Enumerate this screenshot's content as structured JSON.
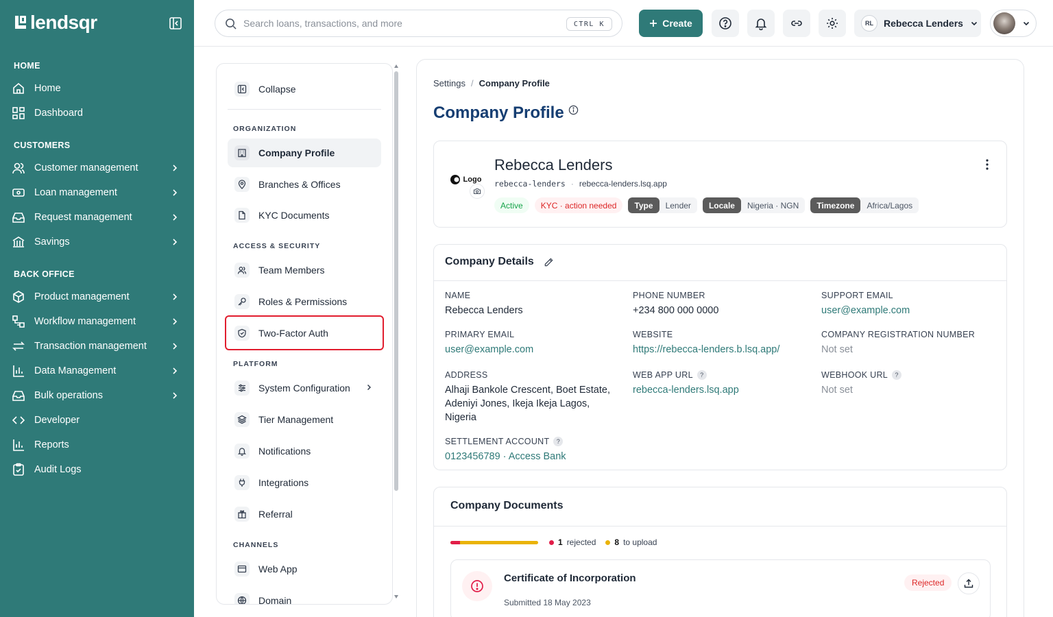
{
  "brand": {
    "name": "lendsqr"
  },
  "sidebar": {
    "sections": [
      {
        "label": "HOME"
      },
      {
        "label": "CUSTOMERS"
      },
      {
        "label": "BACK OFFICE"
      }
    ],
    "items": [
      {
        "label": "Home",
        "icon": "home-icon"
      },
      {
        "label": "Dashboard",
        "icon": "dashboard-icon"
      },
      {
        "label": "Customer management",
        "icon": "users-icon"
      },
      {
        "label": "Loan management",
        "icon": "loan-icon"
      },
      {
        "label": "Request management",
        "icon": "inbox-icon"
      },
      {
        "label": "Savings",
        "icon": "savings-icon"
      },
      {
        "label": "Product management",
        "icon": "box-icon"
      },
      {
        "label": "Workflow management",
        "icon": "workflow-icon"
      },
      {
        "label": "Transaction management",
        "icon": "transfer-icon"
      },
      {
        "label": "Data Management",
        "icon": "bar-chart-icon"
      },
      {
        "label": "Bulk operations",
        "icon": "tray-icon"
      },
      {
        "label": "Developer",
        "icon": "code-icon"
      },
      {
        "label": "Reports",
        "icon": "report-icon"
      },
      {
        "label": "Audit Logs",
        "icon": "clipboard-icon"
      }
    ]
  },
  "topbar": {
    "search_placeholder": "Search loans, transactions, and more",
    "shortcut": "CTRL K",
    "create_label": "Create",
    "account_initials": "RL",
    "account_name": "Rebecca Lenders"
  },
  "settings_nav": {
    "collapse_label": "Collapse",
    "sections": [
      "ORGANIZATION",
      "ACCESS & SECURITY",
      "PLATFORM",
      "CHANNELS"
    ],
    "items": [
      {
        "label": "Company Profile",
        "active": true
      },
      {
        "label": "Branches & Offices"
      },
      {
        "label": "KYC Documents"
      },
      {
        "label": "Team Members"
      },
      {
        "label": "Roles & Permissions"
      },
      {
        "label": "Two-Factor Auth"
      },
      {
        "label": "System Configuration"
      },
      {
        "label": "Tier Management"
      },
      {
        "label": "Notifications"
      },
      {
        "label": "Integrations"
      },
      {
        "label": "Referral"
      },
      {
        "label": "Web App"
      },
      {
        "label": "Domain"
      }
    ]
  },
  "breadcrumb": {
    "parent": "Settings",
    "sep": "/",
    "current": "Company Profile"
  },
  "page_title": "Company Profile",
  "profile": {
    "logo_text": "Logo",
    "name": "Rebecca Lenders",
    "slug": "rebecca-lenders",
    "dot": "·",
    "domain": "rebecca-lenders.lsq.app",
    "status": "Active",
    "kyc": "KYC · action needed",
    "tags": [
      {
        "key": "Type",
        "value": "Lender"
      },
      {
        "key": "Locale",
        "value": "Nigeria · NGN"
      },
      {
        "key": "Timezone",
        "value": "Africa/Lagos"
      }
    ]
  },
  "details": {
    "title": "Company Details",
    "fields": {
      "name": {
        "label": "NAME",
        "value": "Rebecca Lenders"
      },
      "phone": {
        "label": "PHONE NUMBER",
        "value": "+234 800 000 0000"
      },
      "support_email": {
        "label": "SUPPORT EMAIL",
        "value": "user@example.com"
      },
      "primary_email": {
        "label": "PRIMARY EMAIL",
        "value": "user@example.com"
      },
      "website": {
        "label": "WEBSITE",
        "value": "https://rebecca-lenders.b.lsq.app/"
      },
      "reg_number": {
        "label": "COMPANY REGISTRATION NUMBER",
        "value": "Not set"
      },
      "address": {
        "label": "ADDRESS",
        "value": "Alhaji Bankole Crescent, Boet Estate, Adeniyi Jones, Ikeja Ikeja Lagos, Nigeria"
      },
      "web_app_url": {
        "label": "WEB APP URL",
        "value": "rebecca-lenders.lsq.app"
      },
      "webhook_url": {
        "label": "WEBHOOK URL",
        "value": "Not set"
      },
      "settlement": {
        "label": "SETTLEMENT ACCOUNT",
        "value": "0123456789 · Access Bank"
      }
    },
    "help": "?"
  },
  "documents": {
    "title": "Company Documents",
    "rejected_count": "1",
    "rejected_label": "rejected",
    "upload_count": "8",
    "upload_label": "to upload",
    "progress_rejected_fraction": 0.11,
    "items": [
      {
        "title": "Certificate of Incorporation",
        "submitted": "Submitted 18 May 2023",
        "status": "Rejected"
      }
    ]
  },
  "colors": {
    "brand": "#2f7a78",
    "title": "#163e72",
    "danger": "#e11d48",
    "warning": "#eab308"
  }
}
